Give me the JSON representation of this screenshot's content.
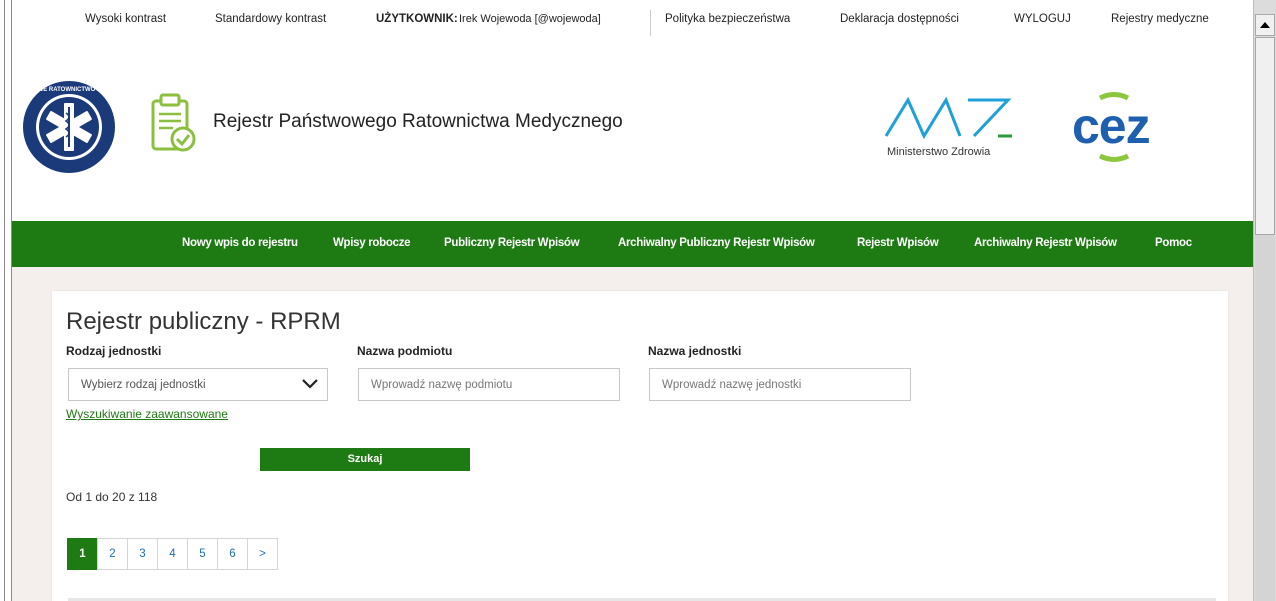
{
  "topbar": {
    "high_contrast": "Wysoki kontrast",
    "standard_contrast": "Standardowy kontrast",
    "user_label": "UŻYTKOWNIK:",
    "user_value": "Irek Wojewoda [@wojewoda]",
    "security_policy": "Polityka bezpieczeństwa",
    "accessibility": "Deklaracja dostępności",
    "logout": "WYLOGUJ",
    "registers": "Rejestry medyczne"
  },
  "header": {
    "title": "Rejestr Państwowego Ratownictwa Medycznego",
    "ministry_name": "Ministerstwo Zdrowia",
    "cez_logo": "cez",
    "emblem_text": "PAŃSTWOWE RATOWNICTWO MEDYCZNE"
  },
  "nav": {
    "items": [
      "Nowy wpis do rejestru",
      "Wpisy robocze",
      "Publiczny Rejestr Wpisów",
      "Archiwalny Publiczny Rejestr Wpisów",
      "Rejestr Wpisów",
      "Archiwalny Rejestr Wpisów",
      "Pomoc"
    ]
  },
  "main": {
    "heading": "Rejestr publiczny - RPRM",
    "unit_type_label": "Rodzaj jednostki",
    "unit_type_value": "Wybierz rodzaj jednostki",
    "entity_name_label": "Nazwa podmiotu",
    "entity_name_placeholder": "Wprowadź nazwę podmiotu",
    "unit_name_label": "Nazwa jednostki",
    "unit_name_placeholder": "Wprowadź nazwę jednostki",
    "advanced_search": "Wyszukiwanie zaawansowane",
    "search_button": "Szukaj",
    "result_count": "Od 1 do 20 z 118"
  },
  "pagination": {
    "pages": [
      "1",
      "2",
      "3",
      "4",
      "5",
      "6",
      ">"
    ],
    "active": "1"
  },
  "colors": {
    "brand_green": "#1e7a13",
    "ministry_blue": "#1ea0d8",
    "cez_blue": "#1e5fb0",
    "cez_green": "#8dc63f",
    "emblem_navy": "#1b3a7a",
    "clipboard_green": "#8cbf3f"
  },
  "icons": {
    "chevron": "chevron-down-icon",
    "emblem": "star-of-life-icon",
    "clipboard": "clipboard-check-icon"
  }
}
